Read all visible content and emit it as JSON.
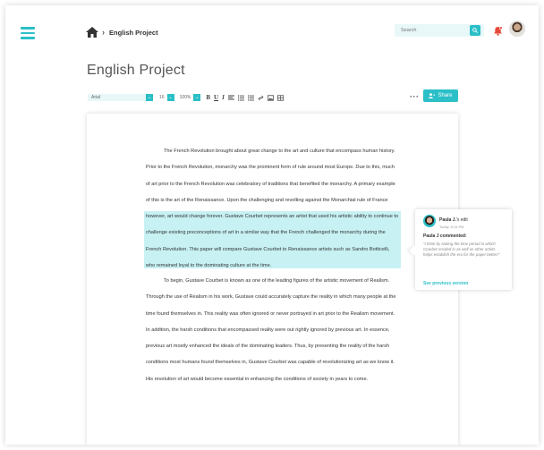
{
  "breadcrumb": {
    "current": "English Project"
  },
  "search": {
    "placeholder": "Search"
  },
  "document": {
    "title": "English Project",
    "toolbar": {
      "font": "Arial",
      "size": "16",
      "zoom": "100%",
      "bold": "B",
      "underline": "U",
      "italic": "I"
    },
    "share_label": "Share",
    "paragraph1": {
      "before": "The French Revolution brought about great change to the art and culture that encompass human history. Prior to the French Revolution, monarchy was the prominent form of rule around most Europe. Due to this, much of art prior to the French Revolution was celebratory of traditions that benefited the monarchy. A primary example of this is the art of the Renaissance. Upon the challenging and revolting against the Monarchial rule of France however, art would change forever.",
      "highlight": "Gustave Courbet represents an artist that used his artistic ability to continue to challenge existing preconceptions of art in a similar way that the French challenged the monarchy during the French Revolution. This paper will compare Gustave Courbet to Renaissance artists such as Sandro Botticelli, who remained loyal to the dominating culture at the time."
    },
    "paragraph2": "To begin, Gustave Courbet is known as one of the leading figures of the artistic movement of Realism. Through the use of Realism in his work, Gustave could accurately capture the reality in which many people at the time found themselves in. This reality was often ignored or never portrayed in art prior to the Realism movement. In addition, the harsh conditions that encompassed reality were out rightly ignored by previous art. In essence, previous art mostly enhanced the ideals of the dominating leaders. Thus, by presenting the reality of the harsh conditions most humans found themselves in, Gustave Courbet was capable of revolutionizing art as we know it. His revolution of art would become essential in enhancing the conditions of society in years to come."
  },
  "comment": {
    "author": "Paula J.",
    "action": "'s edit",
    "time": "Today, 8:15 PM",
    "header": "Paula J commented:",
    "text": "\"I think by stating the time period in which Courbet resided in as well as other artists helps establish the era for the paper better!\"",
    "link": "See previous version"
  },
  "colors": {
    "accent": "#2bbfc7",
    "highlight": "#c7f1f3",
    "bell": "#e84a3c"
  }
}
